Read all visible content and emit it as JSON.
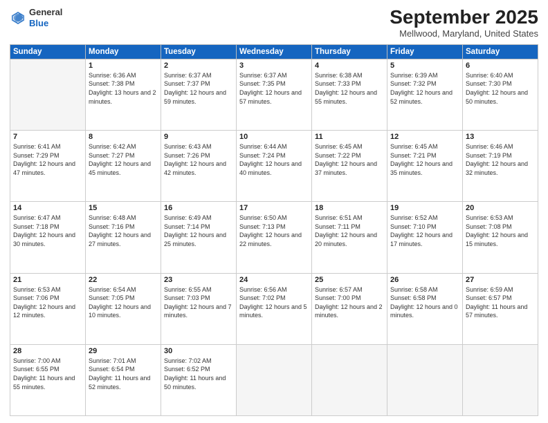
{
  "logo": {
    "general": "General",
    "blue": "Blue"
  },
  "header": {
    "month": "September 2025",
    "location": "Mellwood, Maryland, United States"
  },
  "days_of_week": [
    "Sunday",
    "Monday",
    "Tuesday",
    "Wednesday",
    "Thursday",
    "Friday",
    "Saturday"
  ],
  "weeks": [
    [
      {
        "day": "",
        "sunrise": "",
        "sunset": "",
        "daylight": "",
        "empty": true
      },
      {
        "day": "1",
        "sunrise": "Sunrise: 6:36 AM",
        "sunset": "Sunset: 7:38 PM",
        "daylight": "Daylight: 13 hours and 2 minutes."
      },
      {
        "day": "2",
        "sunrise": "Sunrise: 6:37 AM",
        "sunset": "Sunset: 7:37 PM",
        "daylight": "Daylight: 12 hours and 59 minutes."
      },
      {
        "day": "3",
        "sunrise": "Sunrise: 6:37 AM",
        "sunset": "Sunset: 7:35 PM",
        "daylight": "Daylight: 12 hours and 57 minutes."
      },
      {
        "day": "4",
        "sunrise": "Sunrise: 6:38 AM",
        "sunset": "Sunset: 7:33 PM",
        "daylight": "Daylight: 12 hours and 55 minutes."
      },
      {
        "day": "5",
        "sunrise": "Sunrise: 6:39 AM",
        "sunset": "Sunset: 7:32 PM",
        "daylight": "Daylight: 12 hours and 52 minutes."
      },
      {
        "day": "6",
        "sunrise": "Sunrise: 6:40 AM",
        "sunset": "Sunset: 7:30 PM",
        "daylight": "Daylight: 12 hours and 50 minutes."
      }
    ],
    [
      {
        "day": "7",
        "sunrise": "Sunrise: 6:41 AM",
        "sunset": "Sunset: 7:29 PM",
        "daylight": "Daylight: 12 hours and 47 minutes."
      },
      {
        "day": "8",
        "sunrise": "Sunrise: 6:42 AM",
        "sunset": "Sunset: 7:27 PM",
        "daylight": "Daylight: 12 hours and 45 minutes."
      },
      {
        "day": "9",
        "sunrise": "Sunrise: 6:43 AM",
        "sunset": "Sunset: 7:26 PM",
        "daylight": "Daylight: 12 hours and 42 minutes."
      },
      {
        "day": "10",
        "sunrise": "Sunrise: 6:44 AM",
        "sunset": "Sunset: 7:24 PM",
        "daylight": "Daylight: 12 hours and 40 minutes."
      },
      {
        "day": "11",
        "sunrise": "Sunrise: 6:45 AM",
        "sunset": "Sunset: 7:22 PM",
        "daylight": "Daylight: 12 hours and 37 minutes."
      },
      {
        "day": "12",
        "sunrise": "Sunrise: 6:45 AM",
        "sunset": "Sunset: 7:21 PM",
        "daylight": "Daylight: 12 hours and 35 minutes."
      },
      {
        "day": "13",
        "sunrise": "Sunrise: 6:46 AM",
        "sunset": "Sunset: 7:19 PM",
        "daylight": "Daylight: 12 hours and 32 minutes."
      }
    ],
    [
      {
        "day": "14",
        "sunrise": "Sunrise: 6:47 AM",
        "sunset": "Sunset: 7:18 PM",
        "daylight": "Daylight: 12 hours and 30 minutes."
      },
      {
        "day": "15",
        "sunrise": "Sunrise: 6:48 AM",
        "sunset": "Sunset: 7:16 PM",
        "daylight": "Daylight: 12 hours and 27 minutes."
      },
      {
        "day": "16",
        "sunrise": "Sunrise: 6:49 AM",
        "sunset": "Sunset: 7:14 PM",
        "daylight": "Daylight: 12 hours and 25 minutes."
      },
      {
        "day": "17",
        "sunrise": "Sunrise: 6:50 AM",
        "sunset": "Sunset: 7:13 PM",
        "daylight": "Daylight: 12 hours and 22 minutes."
      },
      {
        "day": "18",
        "sunrise": "Sunrise: 6:51 AM",
        "sunset": "Sunset: 7:11 PM",
        "daylight": "Daylight: 12 hours and 20 minutes."
      },
      {
        "day": "19",
        "sunrise": "Sunrise: 6:52 AM",
        "sunset": "Sunset: 7:10 PM",
        "daylight": "Daylight: 12 hours and 17 minutes."
      },
      {
        "day": "20",
        "sunrise": "Sunrise: 6:53 AM",
        "sunset": "Sunset: 7:08 PM",
        "daylight": "Daylight: 12 hours and 15 minutes."
      }
    ],
    [
      {
        "day": "21",
        "sunrise": "Sunrise: 6:53 AM",
        "sunset": "Sunset: 7:06 PM",
        "daylight": "Daylight: 12 hours and 12 minutes."
      },
      {
        "day": "22",
        "sunrise": "Sunrise: 6:54 AM",
        "sunset": "Sunset: 7:05 PM",
        "daylight": "Daylight: 12 hours and 10 minutes."
      },
      {
        "day": "23",
        "sunrise": "Sunrise: 6:55 AM",
        "sunset": "Sunset: 7:03 PM",
        "daylight": "Daylight: 12 hours and 7 minutes."
      },
      {
        "day": "24",
        "sunrise": "Sunrise: 6:56 AM",
        "sunset": "Sunset: 7:02 PM",
        "daylight": "Daylight: 12 hours and 5 minutes."
      },
      {
        "day": "25",
        "sunrise": "Sunrise: 6:57 AM",
        "sunset": "Sunset: 7:00 PM",
        "daylight": "Daylight: 12 hours and 2 minutes."
      },
      {
        "day": "26",
        "sunrise": "Sunrise: 6:58 AM",
        "sunset": "Sunset: 6:58 PM",
        "daylight": "Daylight: 12 hours and 0 minutes."
      },
      {
        "day": "27",
        "sunrise": "Sunrise: 6:59 AM",
        "sunset": "Sunset: 6:57 PM",
        "daylight": "Daylight: 11 hours and 57 minutes."
      }
    ],
    [
      {
        "day": "28",
        "sunrise": "Sunrise: 7:00 AM",
        "sunset": "Sunset: 6:55 PM",
        "daylight": "Daylight: 11 hours and 55 minutes."
      },
      {
        "day": "29",
        "sunrise": "Sunrise: 7:01 AM",
        "sunset": "Sunset: 6:54 PM",
        "daylight": "Daylight: 11 hours and 52 minutes."
      },
      {
        "day": "30",
        "sunrise": "Sunrise: 7:02 AM",
        "sunset": "Sunset: 6:52 PM",
        "daylight": "Daylight: 11 hours and 50 minutes."
      },
      {
        "day": "",
        "sunrise": "",
        "sunset": "",
        "daylight": "",
        "empty": true
      },
      {
        "day": "",
        "sunrise": "",
        "sunset": "",
        "daylight": "",
        "empty": true
      },
      {
        "day": "",
        "sunrise": "",
        "sunset": "",
        "daylight": "",
        "empty": true
      },
      {
        "day": "",
        "sunrise": "",
        "sunset": "",
        "daylight": "",
        "empty": true
      }
    ]
  ]
}
